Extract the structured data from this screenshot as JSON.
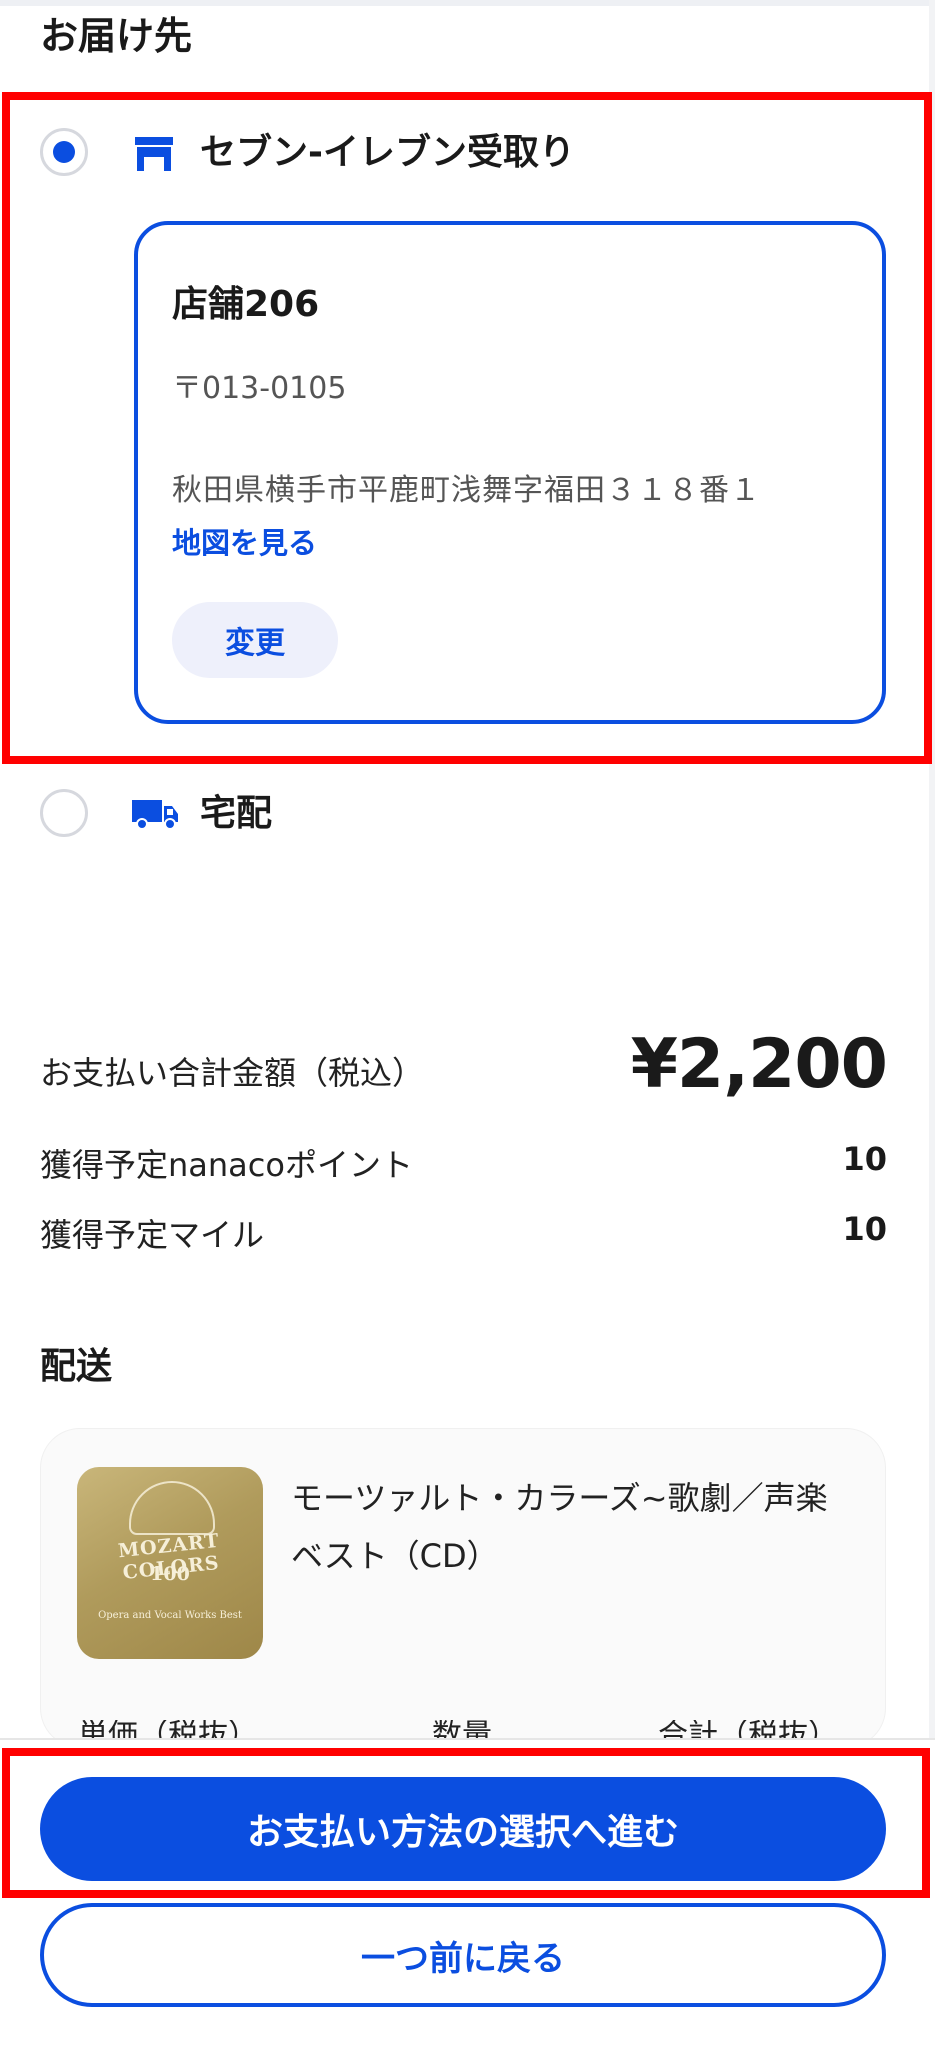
{
  "section": {
    "title": "お届け先"
  },
  "options": {
    "seven": {
      "label": "セブン-イレブン受取り",
      "selected": true,
      "icon": "store-icon"
    },
    "home": {
      "label": "宅配",
      "selected": false,
      "icon": "truck-icon"
    }
  },
  "store": {
    "name": "店舗206",
    "zip": "〒013-0105",
    "address": "秋田県横手市平鹿町浅舞字福田３１８番１",
    "map_link": "地図を見る",
    "change_label": "変更"
  },
  "summary": {
    "total_label": "お支払い合計金額（税込）",
    "total_value": "¥2,200",
    "points_label": "獲得予定nanacoポイント",
    "points_value": "10",
    "miles_label": "獲得予定マイル",
    "miles_value": "10"
  },
  "delivery": {
    "title": "配送",
    "product_name": "モーツァルト・カラーズ~歌劇／声楽ベスト（CD）",
    "thumbnail": {
      "brand": "MOZART COLORS",
      "number": "100",
      "subtitle": "Opera and Vocal Works Best"
    },
    "columns": [
      "単価（税抜）",
      "数量",
      "合計（税抜）"
    ]
  },
  "buttons": {
    "proceed": "お支払い方法の選択へ進む",
    "back": "一つ前に戻る"
  },
  "colors": {
    "accent": "#0b4ee0",
    "highlight_frame": "#ff0000"
  }
}
